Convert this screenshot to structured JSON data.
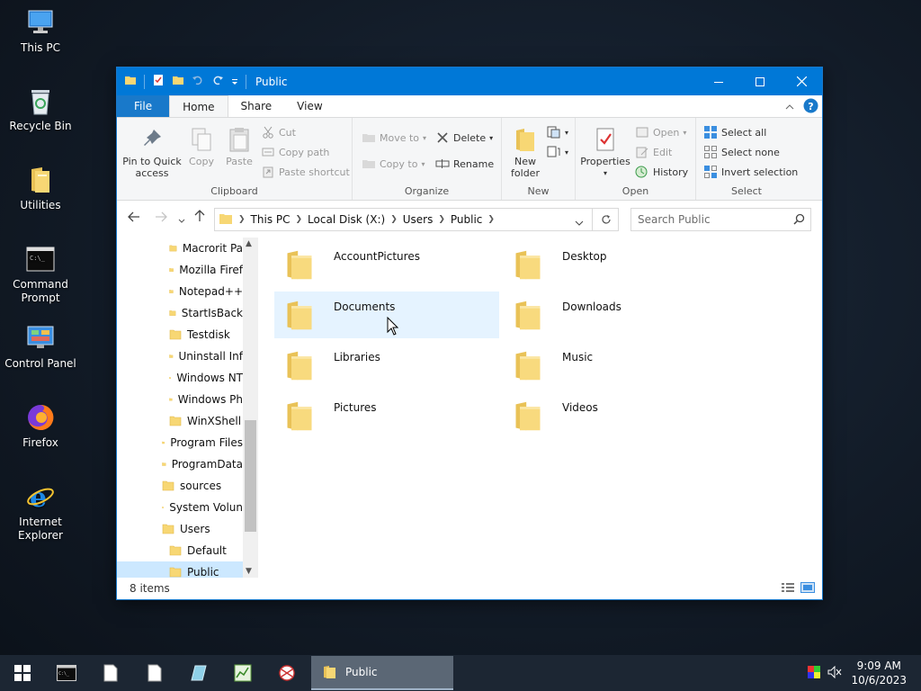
{
  "desktop_icons": [
    {
      "label": "This PC",
      "icon": "this-pc-icon"
    },
    {
      "label": "Recycle Bin",
      "icon": "recycle-bin-icon"
    },
    {
      "label": "Utilities",
      "icon": "folder-icon"
    },
    {
      "label": "Command Prompt",
      "icon": "command-prompt-icon"
    },
    {
      "label": "Control Panel",
      "icon": "control-panel-icon"
    },
    {
      "label": "Firefox",
      "icon": "firefox-icon"
    },
    {
      "label": "Internet Explorer",
      "icon": "internet-explorer-icon"
    }
  ],
  "window": {
    "title": "Public",
    "controls": {
      "minimize": "minimize-icon",
      "maximize": "maximize-icon",
      "close": "close-icon"
    }
  },
  "ribbon_tabs": {
    "file": "File",
    "home": "Home",
    "share": "Share",
    "view": "View"
  },
  "ribbon": {
    "clipboard": {
      "label": "Clipboard",
      "pin": "Pin to Quick access",
      "copy": "Copy",
      "paste": "Paste",
      "cut": "Cut",
      "copy_path": "Copy path",
      "paste_shortcut": "Paste shortcut"
    },
    "organize": {
      "label": "Organize",
      "move_to": "Move to",
      "copy_to": "Copy to",
      "delete": "Delete",
      "rename": "Rename"
    },
    "new": {
      "label": "New",
      "new_folder": "New folder"
    },
    "open": {
      "label": "Open",
      "properties": "Properties",
      "open": "Open",
      "edit": "Edit",
      "history": "History"
    },
    "select": {
      "label": "Select",
      "select_all": "Select all",
      "select_none": "Select none",
      "invert": "Invert selection"
    }
  },
  "address": {
    "crumbs": [
      "This PC",
      "Local Disk (X:)",
      "Users",
      "Public"
    ],
    "search_placeholder": "Search Public"
  },
  "nav_tree": [
    {
      "label": "Macrorit Pa",
      "indent": 2
    },
    {
      "label": "Mozilla Firef",
      "indent": 2
    },
    {
      "label": "Notepad++",
      "indent": 2
    },
    {
      "label": "StartIsBack",
      "indent": 2
    },
    {
      "label": "Testdisk",
      "indent": 2
    },
    {
      "label": "Uninstall Inf",
      "indent": 2
    },
    {
      "label": "Windows NT",
      "indent": 2
    },
    {
      "label": "Windows Ph",
      "indent": 2
    },
    {
      "label": "WinXShell",
      "indent": 2
    },
    {
      "label": "Program Files",
      "indent": 1
    },
    {
      "label": "ProgramData",
      "indent": 1
    },
    {
      "label": "sources",
      "indent": 1
    },
    {
      "label": "System Volun",
      "indent": 1
    },
    {
      "label": "Users",
      "indent": 1
    },
    {
      "label": "Default",
      "indent": 2
    },
    {
      "label": "Public",
      "indent": 2,
      "selected": true
    }
  ],
  "files": [
    {
      "name": "AccountPictures"
    },
    {
      "name": "Desktop"
    },
    {
      "name": "Documents"
    },
    {
      "name": "Downloads"
    },
    {
      "name": "Libraries"
    },
    {
      "name": "Music"
    },
    {
      "name": "Pictures"
    },
    {
      "name": "Videos"
    }
  ],
  "status": {
    "items": "8 items"
  },
  "taskbar": {
    "active_app": "Public",
    "time": "9:09 AM",
    "date": "10/6/2023"
  },
  "colors": {
    "accent": "#0078d7",
    "folder": "#f7d774",
    "selection": "#cce8ff"
  }
}
